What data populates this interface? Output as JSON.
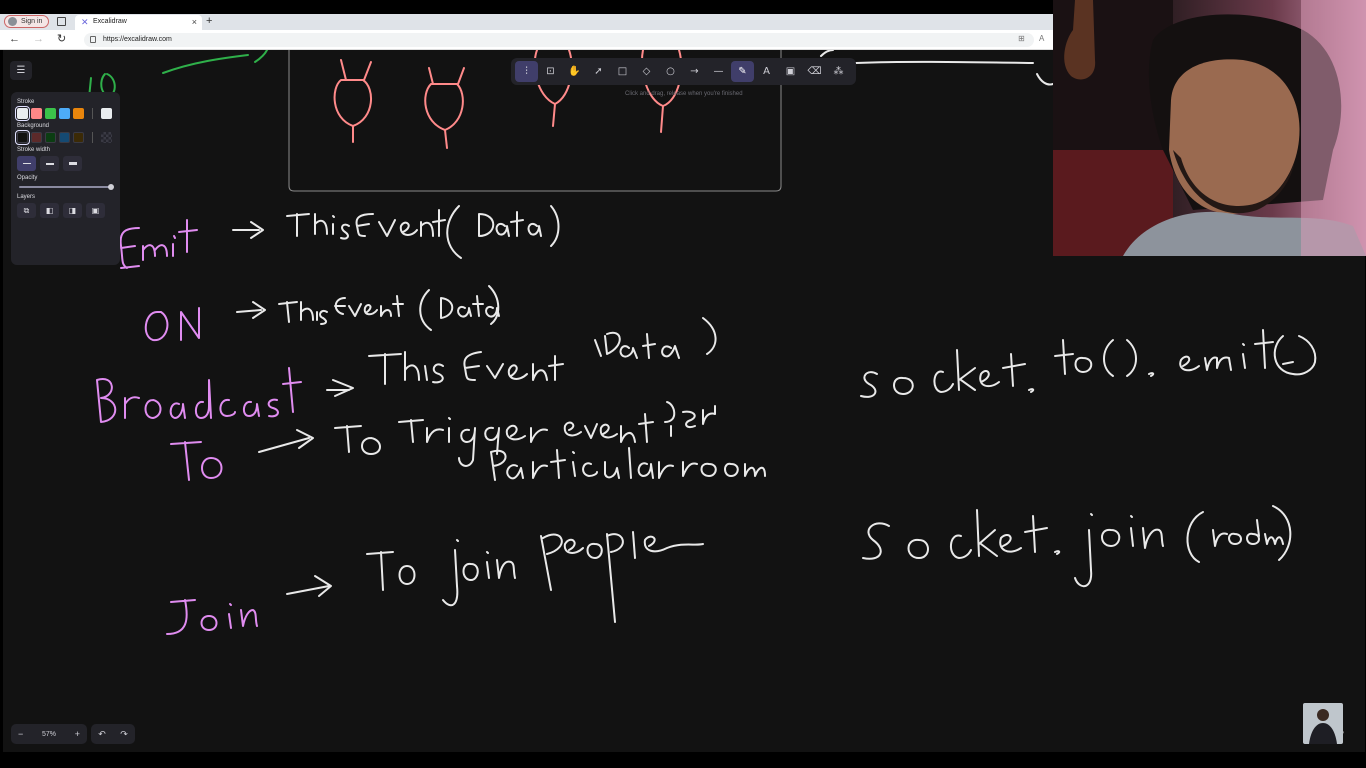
{
  "browser": {
    "sign_in_label": "Sign in",
    "tab_title": "Excalidraw",
    "url": "https://excalidraw.com"
  },
  "toolbar": {
    "hint": "Click and drag, release when you're finished",
    "tools": [
      {
        "name": "lock-tool",
        "icon": "lock-icon",
        "glyph": "⊡"
      },
      {
        "name": "hand-tool",
        "icon": "hand-icon",
        "glyph": "✋"
      },
      {
        "name": "selection-tool",
        "icon": "pointer-icon",
        "glyph": "➚"
      },
      {
        "name": "rectangle-tool",
        "icon": "rectangle-icon",
        "glyph": "□"
      },
      {
        "name": "diamond-tool",
        "icon": "diamond-icon",
        "glyph": "◇"
      },
      {
        "name": "ellipse-tool",
        "icon": "ellipse-icon",
        "glyph": "○"
      },
      {
        "name": "arrow-tool",
        "icon": "arrow-icon",
        "glyph": "→"
      },
      {
        "name": "line-tool",
        "icon": "line-icon",
        "glyph": "—"
      },
      {
        "name": "draw-tool",
        "icon": "pencil-icon",
        "glyph": "✎",
        "active": true
      },
      {
        "name": "text-tool",
        "icon": "text-icon",
        "glyph": "A"
      },
      {
        "name": "image-tool",
        "icon": "image-icon",
        "glyph": "▣"
      },
      {
        "name": "eraser-tool",
        "icon": "eraser-icon",
        "glyph": "⌫"
      },
      {
        "name": "extra-tools",
        "icon": "shapes-icon",
        "glyph": "⁂"
      }
    ]
  },
  "properties": {
    "stroke_label": "Stroke",
    "background_label": "Background",
    "stroke_width_label": "Stroke width",
    "opacity_label": "Opacity",
    "layers_label": "Layers",
    "stroke_colors": [
      "#e9ecef",
      "#ff8787",
      "#3bc24a",
      "#4dabf7",
      "#e8850c"
    ],
    "stroke_current": "#e9ecef",
    "background_colors": [
      "#121212",
      "#5c2a2a",
      "#0b3d12",
      "#154a73",
      "#3b2a06"
    ],
    "opacity_value": 1.0
  },
  "zoom": {
    "level": "57%",
    "minus": "−",
    "plus": "+"
  },
  "colors": {
    "canvas_bg": "#121212",
    "ink_white": "#e9e9e9",
    "ink_violet": "#e08cf0",
    "ink_red": "#ff8a8a",
    "ink_green": "#2fb04a",
    "accent": "#6965db"
  }
}
